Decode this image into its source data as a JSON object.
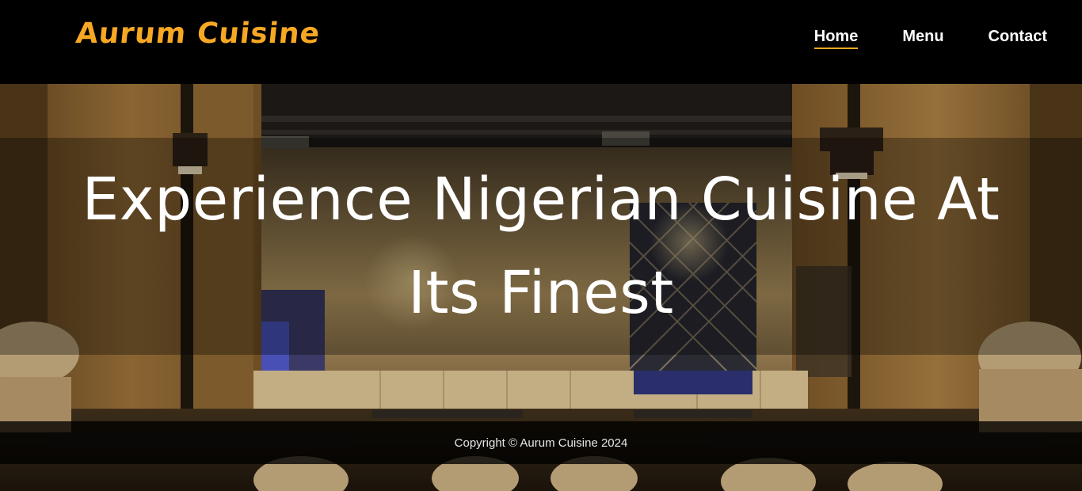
{
  "header": {
    "logo": "Aurum Cuisine",
    "nav": [
      {
        "label": "Home",
        "active": true
      },
      {
        "label": "Menu",
        "active": false
      },
      {
        "label": "Contact",
        "active": false
      }
    ]
  },
  "hero": {
    "headline": "Experience Nigerian Cuisine At Its Finest",
    "background": "restaurant-interior-photo"
  },
  "footer": {
    "copyright": "Copyright © Aurum Cuisine 2024"
  },
  "colors": {
    "accent": "#f7a823",
    "header_bg": "#000000",
    "text": "#ffffff"
  }
}
